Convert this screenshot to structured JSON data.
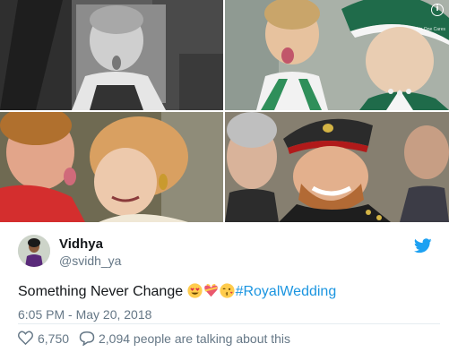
{
  "photos": {
    "watermark_text": "No One Cares",
    "info_icon": "info-icon"
  },
  "author": {
    "display_name": "Vidhya",
    "handle": "@svidh_ya",
    "platform_icon": "twitter-bird-icon",
    "brand_color": "#1da1f2"
  },
  "tweet": {
    "text_before": "Something  Never Change ",
    "emojis": [
      "heart-eyes-emoji",
      "gift-heart-emoji",
      "kissing-heart-emoji"
    ],
    "hashtag": "#RoyalWedding",
    "hashtag_color": "#1b95e0",
    "timestamp": "6:05 PM - May 20, 2018"
  },
  "actions": {
    "like_count": "6,750",
    "talking_text": "2,094 people are talking about this"
  }
}
